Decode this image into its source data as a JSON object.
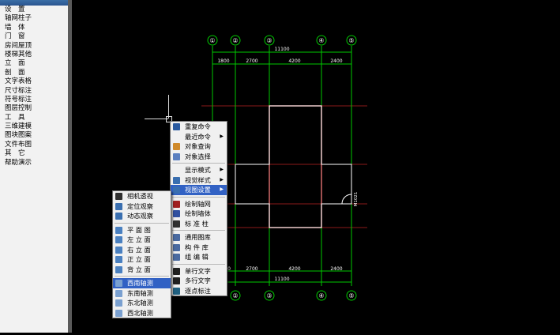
{
  "left_menu": {
    "items": [
      "设　置",
      "轴网柱子",
      "墙　体",
      "门　窗",
      "房间屋顶",
      "楼梯其他",
      "立　面",
      "剖　面",
      "文字表格",
      "尺寸标注",
      "符号标注",
      "图层控制",
      "工　具",
      "三维建模",
      "图块图案",
      "文件布图",
      "其　它",
      "帮助演示"
    ]
  },
  "drawing": {
    "axis_labels": [
      "①",
      "②",
      "③",
      "④",
      "⑤"
    ],
    "top_total": "11100",
    "top_dims": [
      "1800",
      "2700",
      "4200",
      "2400"
    ],
    "bottom_total": "11100",
    "bottom_dims": [
      "0",
      "2700",
      "4200",
      "2400"
    ],
    "side_label": "M1021",
    "colors": {
      "axis": "#00c800",
      "grid": "#8b1a1a",
      "wall": "#ffffff",
      "room": "#d46a6a",
      "text": "#ffffff"
    }
  },
  "context_menu": {
    "items": [
      {
        "label": "重复命令",
        "icon": "repeat-arrow-icon",
        "submenu": false
      },
      {
        "label": "最近命令",
        "icon": "",
        "submenu": true
      },
      {
        "label": "对象查询",
        "icon": "query-icon",
        "submenu": false
      },
      {
        "label": "对象选择",
        "icon": "select-icon",
        "submenu": false
      },
      {
        "sep": true
      },
      {
        "label": "显示模式",
        "icon": "",
        "submenu": true
      },
      {
        "label": "视觉样式",
        "icon": "globe-icon",
        "submenu": true
      },
      {
        "label": "视图设置",
        "icon": "view-icon",
        "submenu": true,
        "highlight": true
      },
      {
        "sep": true
      },
      {
        "label": "绘制轴网",
        "icon": "grid-icon",
        "submenu": false
      },
      {
        "label": "绘制墙体",
        "icon": "wall-icon",
        "submenu": false
      },
      {
        "label": "标 准 柱",
        "icon": "column-icon",
        "submenu": false
      },
      {
        "sep": true
      },
      {
        "label": "通用图库",
        "icon": "library-icon",
        "submenu": false
      },
      {
        "label": "构 件 库",
        "icon": "component-icon",
        "submenu": false
      },
      {
        "label": "组 编 辑",
        "icon": "group-edit-icon",
        "submenu": false
      },
      {
        "sep": true
      },
      {
        "label": "单行文字",
        "icon": "text-icon",
        "submenu": false
      },
      {
        "label": "多行文字",
        "icon": "multitext-icon",
        "submenu": false
      },
      {
        "label": "逐点标注",
        "icon": "point-mark-icon",
        "submenu": false
      }
    ]
  },
  "submenu": {
    "items": [
      {
        "label": "相机透视",
        "icon": "camera-icon"
      },
      {
        "label": "定位观察",
        "icon": "locate-icon"
      },
      {
        "label": "动态观察",
        "icon": "orbit-icon"
      },
      {
        "sep": true
      },
      {
        "label": "平 面 图",
        "icon": "plan-icon"
      },
      {
        "label": "左 立 面",
        "icon": "left-elev-icon"
      },
      {
        "label": "右 立 面",
        "icon": "right-elev-icon"
      },
      {
        "label": "正 立 面",
        "icon": "front-elev-icon"
      },
      {
        "label": "背 立 面",
        "icon": "back-elev-icon"
      },
      {
        "sep": true
      },
      {
        "label": "西南轴测",
        "icon": "sw-iso-icon",
        "highlight": true
      },
      {
        "label": "东南轴测",
        "icon": "se-iso-icon"
      },
      {
        "label": "东北轴测",
        "icon": "ne-iso-icon"
      },
      {
        "label": "西北轴测",
        "icon": "nw-iso-icon"
      }
    ]
  }
}
